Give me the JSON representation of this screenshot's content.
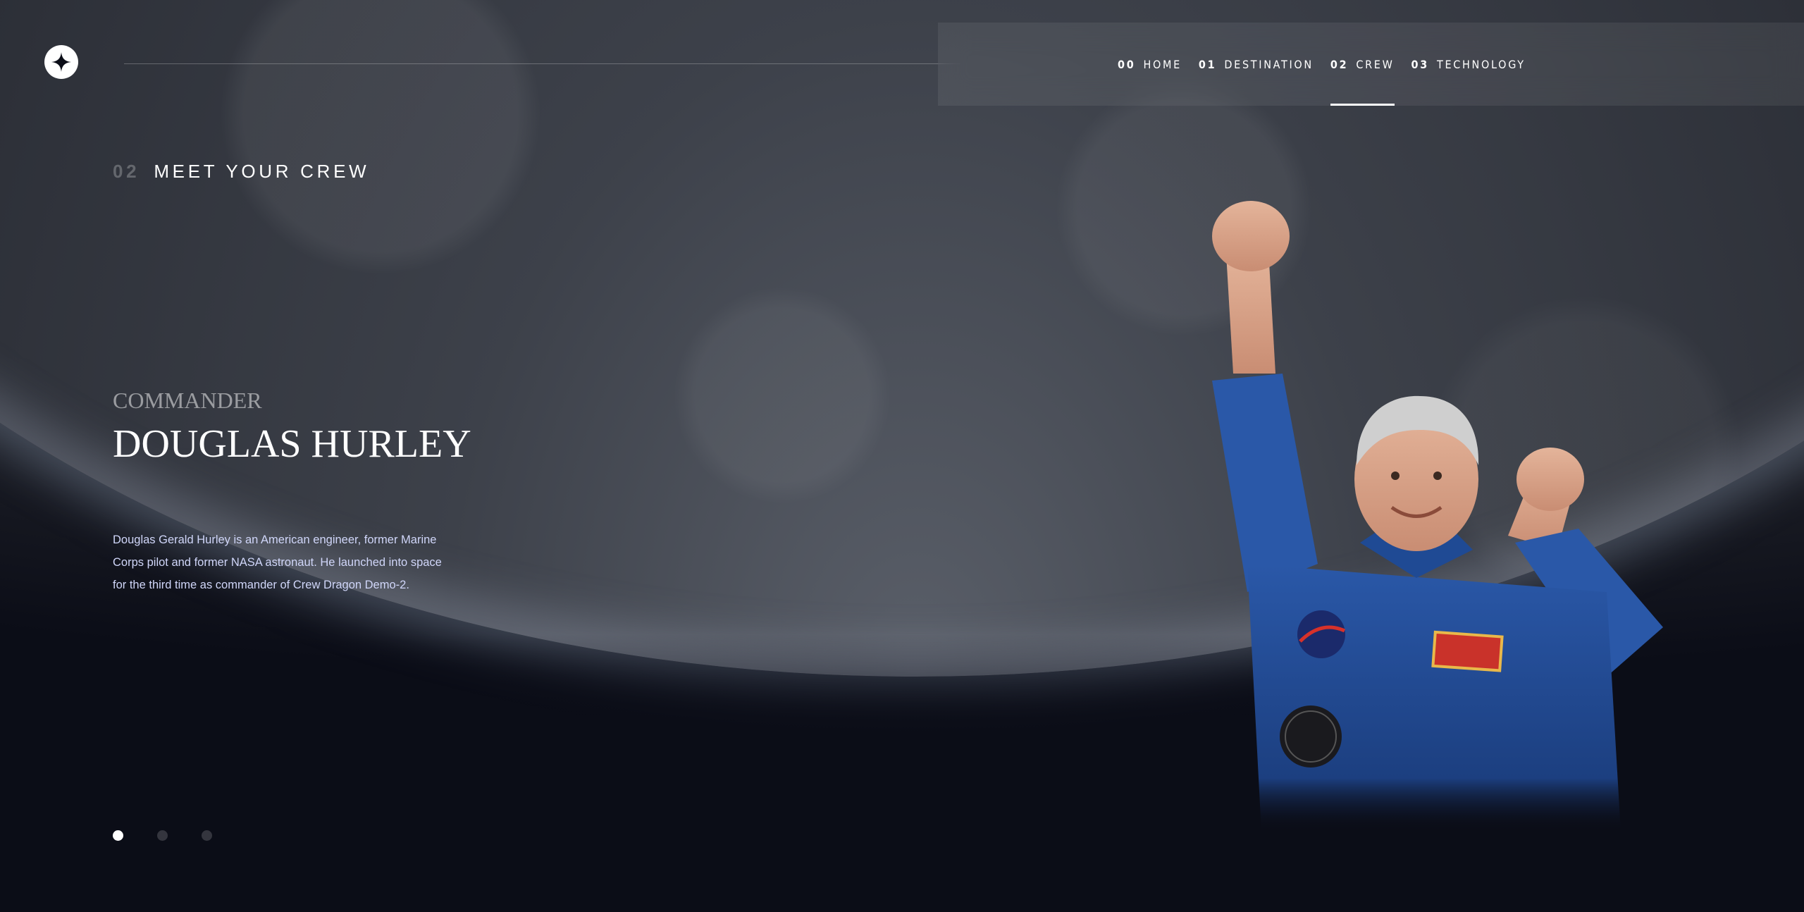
{
  "nav": {
    "items": [
      {
        "num": "00",
        "label": "HOME"
      },
      {
        "num": "01",
        "label": "DESTINATION"
      },
      {
        "num": "02",
        "label": "CREW"
      },
      {
        "num": "03",
        "label": "TECHNOLOGY"
      }
    ],
    "active_index": 2
  },
  "heading": {
    "num": "02",
    "title": "MEET YOUR CREW"
  },
  "crew": {
    "role": "Commander",
    "name": "Douglas Hurley",
    "bio": "Douglas Gerald Hurley is an American engineer, former Marine Corps pilot and former NASA astronaut. He launched into space for the third time as commander of Crew Dragon Demo-2."
  },
  "pager": {
    "count": 3,
    "active_index": 0
  },
  "icons": {
    "logo": "star-logo-icon"
  },
  "colors": {
    "background": "#0b0d17",
    "accent_text": "#d0d6f9",
    "white": "#ffffff"
  }
}
